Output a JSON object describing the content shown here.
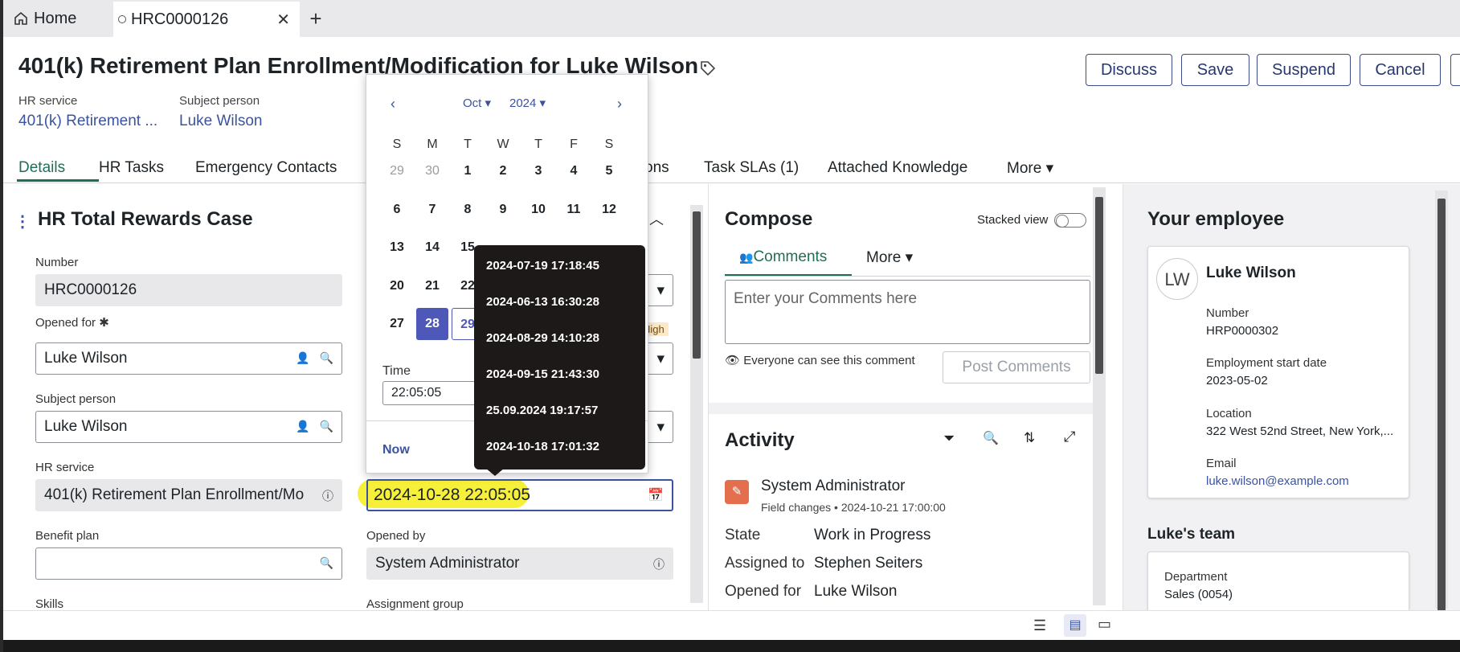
{
  "tabs": [
    {
      "label": "Home"
    },
    {
      "label": "HRC0000126"
    }
  ],
  "header": {
    "title": "401(k) Retirement Plan Enrollment/Modification for Luke Wilson",
    "buttons": {
      "discuss": "Discuss",
      "save": "Save",
      "suspend": "Suspend",
      "cancel": "Cancel"
    },
    "meta": [
      {
        "label": "HR service",
        "value": "401(k) Retirement ..."
      },
      {
        "label": "Subject person",
        "value": "Luke Wilson"
      }
    ]
  },
  "nav_tabs": [
    "Details",
    "HR Tasks",
    "Emergency Contacts",
    "ons",
    "Task SLAs (1)",
    "Attached Knowledge",
    "More"
  ],
  "form": {
    "section_title": "HR Total Rewards Case",
    "number_label": "Number",
    "number_value": "HRC0000126",
    "opened_for_label": "Opened for",
    "opened_for_value": "Luke Wilson",
    "subject_label": "Subject person",
    "subject_value": "Luke Wilson",
    "hr_service_label": "HR service",
    "hr_service_value": "401(k) Retirement Plan Enrollment/Mo",
    "benefit_label": "Benefit plan",
    "benefit_value": "",
    "skills_label": "Skills",
    "opened_by_label": "Opened by",
    "opened_by_value": "System Administrator",
    "assignment_label": "Assignment group",
    "priority_badge": "High",
    "date_value": "2024-10-28 22:05:05"
  },
  "calendar": {
    "month": "Oct",
    "year": "2024",
    "dow": [
      "S",
      "M",
      "T",
      "W",
      "T",
      "F",
      "S"
    ],
    "weeks": [
      [
        "29",
        "30",
        "1",
        "2",
        "3",
        "4",
        "5"
      ],
      [
        "6",
        "7",
        "8",
        "9",
        "10",
        "11",
        "12"
      ],
      [
        "13",
        "14",
        "15",
        "",
        "",
        "",
        ""
      ],
      [
        "20",
        "21",
        "22",
        "",
        "",
        "",
        ""
      ],
      [
        "27",
        "28",
        "29",
        "",
        "",
        "",
        ""
      ]
    ],
    "time_label": "Time",
    "time_value": "22:05:05",
    "now_label": "Now"
  },
  "history": [
    "2024-07-19 17:18:45",
    "2024-06-13 16:30:28",
    "2024-08-29 14:10:28",
    "2024-09-15 21:43:30",
    "25.09.2024 19:17:57",
    "2024-10-18 17:01:32"
  ],
  "compose": {
    "title": "Compose",
    "stacked_label": "Stacked view",
    "tab_comments": "Comments",
    "tab_more": "More",
    "placeholder": "Enter your Comments here",
    "visibility": "Everyone can see this comment",
    "post_button": "Post Comments"
  },
  "activity": {
    "title": "Activity",
    "author": "System Administrator",
    "meta": "Field changes • 2024-10-21 17:00:00",
    "rows": [
      {
        "label": "State",
        "value": "Work in Progress"
      },
      {
        "label": "Assigned to",
        "value": "Stephen Seiters"
      },
      {
        "label": "Opened for",
        "value": "Luke Wilson"
      }
    ]
  },
  "employee": {
    "title": "Your employee",
    "initials": "LW",
    "name": "Luke Wilson",
    "fields": [
      {
        "label": "Number",
        "value": "HRP0000302"
      },
      {
        "label": "Employment start date",
        "value": "2023-05-02"
      },
      {
        "label": "Location",
        "value": "322 West 52nd Street, New York,..."
      },
      {
        "label": "Email",
        "value": "luke.wilson@example.com"
      }
    ],
    "team_title": "Luke's team",
    "department_label": "Department",
    "department_value": "Sales (0054)"
  },
  "colors": {
    "accent": "#3b53a0",
    "highlight": "#f6f03b",
    "selected_day": "#4e58b8",
    "tooltip_bg": "#1c1918"
  }
}
